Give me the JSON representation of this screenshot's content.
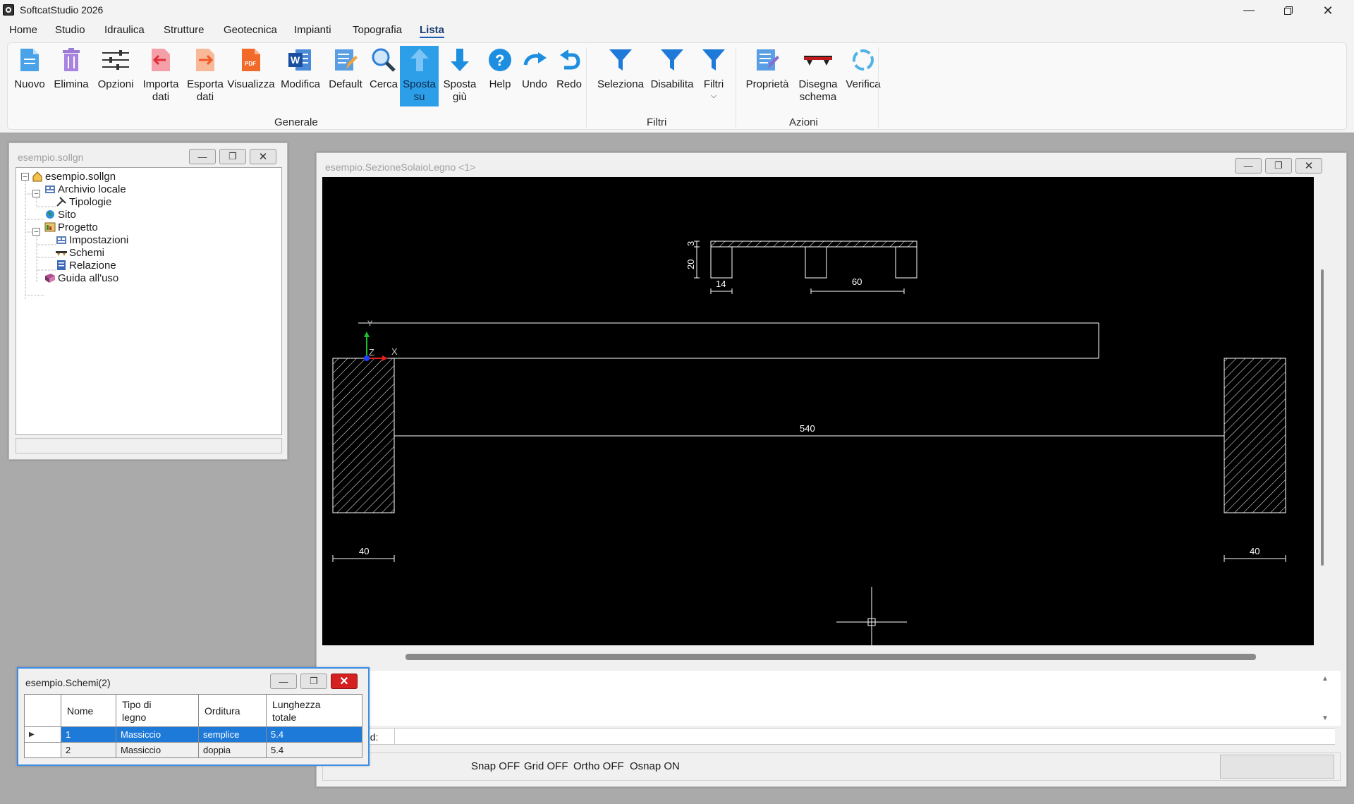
{
  "app": {
    "title": "SoftcatStudio 2026"
  },
  "menu": [
    "Home",
    "Studio",
    "Idraulica",
    "Strutture",
    "Geotecnica",
    "Impianti",
    "Topografia",
    "Lista"
  ],
  "ribbon": {
    "buttons": [
      {
        "label": "Nuovo",
        "icon": "new-document-icon"
      },
      {
        "label": "Elimina",
        "icon": "trash-icon"
      },
      {
        "label": "Opzioni",
        "icon": "sliders-icon"
      },
      {
        "label": "Importa\ndati",
        "icon": "import-arrow-icon"
      },
      {
        "label": "Esporta\ndati",
        "icon": "export-arrow-icon"
      },
      {
        "label": "Visualizza",
        "icon": "pdf-icon"
      },
      {
        "label": "Modifica",
        "icon": "word-icon"
      },
      {
        "label": "Default",
        "icon": "edit-document-icon"
      },
      {
        "label": "Cerca",
        "icon": "magnifier-icon"
      },
      {
        "label": "Sposta\nsu",
        "icon": "arrow-up-icon"
      },
      {
        "label": "Sposta\ngiù",
        "icon": "arrow-down-icon"
      },
      {
        "label": "Help",
        "icon": "help-icon"
      },
      {
        "label": "Undo",
        "icon": "undo-icon"
      },
      {
        "label": "Redo",
        "icon": "redo-icon"
      },
      {
        "label": "Seleziona",
        "icon": "filter-icon"
      },
      {
        "label": "Disabilita",
        "icon": "filter-icon"
      },
      {
        "label": "Filtri",
        "icon": "filter-dropdown-icon"
      },
      {
        "label": "Proprietà",
        "icon": "properties-icon"
      },
      {
        "label": "Disegna\nschema",
        "icon": "beam-icon"
      },
      {
        "label": "Verifica",
        "icon": "refresh-icon"
      }
    ],
    "groups": [
      "Generale",
      "Filtri",
      "Azioni"
    ]
  },
  "tree_window": {
    "title": "esempio.sollgn",
    "items": [
      "esempio.sollgn",
      "Archivio locale",
      "Tipologie",
      "Sito",
      "Progetto",
      "Impostazioni",
      "Schemi",
      "Relazione",
      "Guida all'uso"
    ]
  },
  "cad_window": {
    "title": "esempio.SezioneSolaioLegno <1>",
    "dims": {
      "h_slab": "3",
      "h_total": "20",
      "beam_width": "14",
      "spacing": "60",
      "span": "540",
      "support_left": "40",
      "support_right": "40"
    },
    "axes": {
      "y": "Y",
      "z": "Z",
      "x": "X"
    },
    "command_label": "nd:",
    "status": [
      "Snap OFF",
      "Grid OFF",
      "Ortho OFF",
      "Osnap ON"
    ]
  },
  "grid_window": {
    "title": "esempio.Schemi(2)",
    "columns": [
      "Nome",
      "Tipo di\nlegno",
      "Orditura",
      "Lunghezza\ntotale"
    ],
    "rows": [
      {
        "nome": "1",
        "tipo": "Massiccio",
        "orditura": "semplice",
        "lunghezza": "5.4"
      },
      {
        "nome": "2",
        "tipo": "Massiccio",
        "orditura": "doppia",
        "lunghezza": "5.4"
      }
    ]
  },
  "colors": {
    "accent": "#2d9ee8",
    "selection": "#1e7ad9",
    "cad_bg": "#000000",
    "mdi_bg": "#aaaaaa"
  }
}
